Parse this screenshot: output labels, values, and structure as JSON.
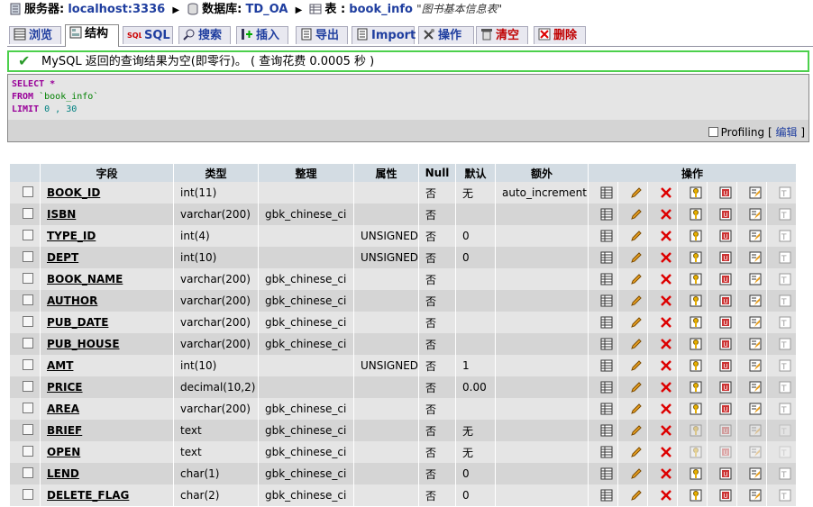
{
  "breadcrumb": {
    "server_label": "服务器:",
    "server_value": "localhost:3336",
    "db_label": "数据库:",
    "db_value": "TD_OA",
    "table_label": "表 :",
    "table_value": "book_info",
    "table_comment": "\"图书基本信息表\""
  },
  "tabs": [
    {
      "label": "浏览",
      "icon": "browse-icon",
      "active": false
    },
    {
      "label": "结构",
      "icon": "structure-icon",
      "active": true
    },
    {
      "label": "SQL",
      "icon": "sql-icon",
      "active": false
    },
    {
      "label": "搜索",
      "icon": "search-icon",
      "active": false
    },
    {
      "label": "插入",
      "icon": "insert-icon",
      "active": false
    },
    {
      "label": "导出",
      "icon": "export-icon",
      "active": false
    },
    {
      "label": "Import",
      "icon": "import-icon",
      "active": false
    },
    {
      "label": "操作",
      "icon": "operations-icon",
      "active": false
    },
    {
      "label": "清空",
      "icon": "empty-icon",
      "active": false
    },
    {
      "label": "删除",
      "icon": "drop-icon",
      "active": false
    }
  ],
  "message": {
    "text": "MySQL 返回的查询结果为空(即零行)。 ( 查询花费  0.0005 秒 )"
  },
  "sql": {
    "select_kw": "SELECT",
    "select_val": "*",
    "from_kw": "FROM",
    "from_val": "`book_info`",
    "limit_kw": "LIMIT",
    "limit_val": "0 , 30",
    "profiling_label": "Profiling",
    "edit_link": "编辑",
    "bracket_open": "[",
    "bracket_close": "]"
  },
  "table": {
    "headers": {
      "field": "字段",
      "type": "类型",
      "collation": "整理",
      "attributes": "属性",
      "null": "Null",
      "default": "默认",
      "extra": "额外",
      "action": "操作"
    },
    "rows": [
      {
        "name": "BOOK_ID",
        "type": "int(11)",
        "collation": "",
        "attr": "",
        "null": "否",
        "default": "无",
        "extra": "auto_increment",
        "enabled": true
      },
      {
        "name": "ISBN",
        "type": "varchar(200)",
        "collation": "gbk_chinese_ci",
        "attr": "",
        "null": "否",
        "default": "",
        "extra": "",
        "enabled": true
      },
      {
        "name": "TYPE_ID",
        "type": "int(4)",
        "collation": "",
        "attr": "UNSIGNED",
        "null": "否",
        "default": "0",
        "extra": "",
        "enabled": true
      },
      {
        "name": "DEPT",
        "type": "int(10)",
        "collation": "",
        "attr": "UNSIGNED",
        "null": "否",
        "default": "0",
        "extra": "",
        "enabled": true
      },
      {
        "name": "BOOK_NAME",
        "type": "varchar(200)",
        "collation": "gbk_chinese_ci",
        "attr": "",
        "null": "否",
        "default": "",
        "extra": "",
        "enabled": true
      },
      {
        "name": "AUTHOR",
        "type": "varchar(200)",
        "collation": "gbk_chinese_ci",
        "attr": "",
        "null": "否",
        "default": "",
        "extra": "",
        "enabled": true
      },
      {
        "name": "PUB_DATE",
        "type": "varchar(200)",
        "collation": "gbk_chinese_ci",
        "attr": "",
        "null": "否",
        "default": "",
        "extra": "",
        "enabled": true
      },
      {
        "name": "PUB_HOUSE",
        "type": "varchar(200)",
        "collation": "gbk_chinese_ci",
        "attr": "",
        "null": "否",
        "default": "",
        "extra": "",
        "enabled": true
      },
      {
        "name": "AMT",
        "type": "int(10)",
        "collation": "",
        "attr": "UNSIGNED",
        "null": "否",
        "default": "1",
        "extra": "",
        "enabled": true
      },
      {
        "name": "PRICE",
        "type": "decimal(10,2)",
        "collation": "",
        "attr": "",
        "null": "否",
        "default": "0.00",
        "extra": "",
        "enabled": true
      },
      {
        "name": "AREA",
        "type": "varchar(200)",
        "collation": "gbk_chinese_ci",
        "attr": "",
        "null": "否",
        "default": "",
        "extra": "",
        "enabled": true
      },
      {
        "name": "BRIEF",
        "type": "text",
        "collation": "gbk_chinese_ci",
        "attr": "",
        "null": "否",
        "default": "无",
        "extra": "",
        "enabled": false
      },
      {
        "name": "OPEN",
        "type": "text",
        "collation": "gbk_chinese_ci",
        "attr": "",
        "null": "否",
        "default": "无",
        "extra": "",
        "enabled": false
      },
      {
        "name": "LEND",
        "type": "char(1)",
        "collation": "gbk_chinese_ci",
        "attr": "",
        "null": "否",
        "default": "0",
        "extra": "",
        "enabled": true
      },
      {
        "name": "DELETE_FLAG",
        "type": "char(2)",
        "collation": "gbk_chinese_ci",
        "attr": "",
        "null": "否",
        "default": "0",
        "extra": "",
        "enabled": true
      }
    ],
    "row_actions": [
      "browse-distinct-icon",
      "edit-icon",
      "drop-icon",
      "primary-key-icon",
      "unique-icon",
      "index-icon",
      "fulltext-icon"
    ]
  },
  "colors": {
    "link": "#1f3e9f",
    "header_bg": "#d3dce3",
    "row_odd": "#e5e5e5",
    "row_even": "#d5d5d5",
    "success_border": "#4cd04c",
    "danger": "#c00000"
  }
}
